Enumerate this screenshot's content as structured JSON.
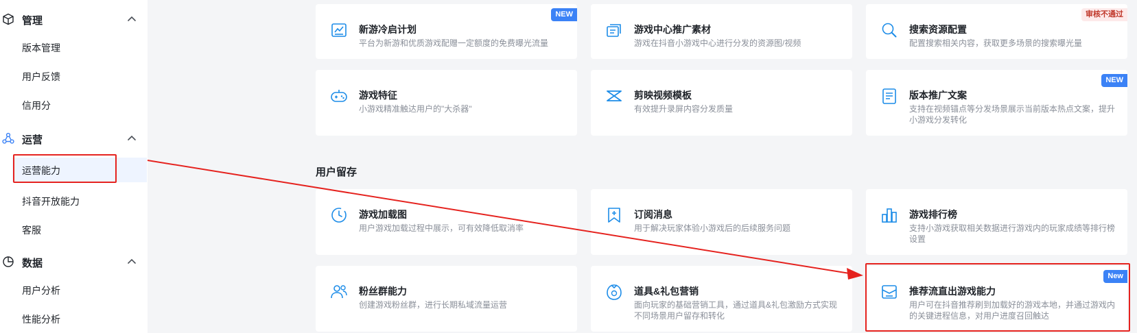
{
  "sidebar": {
    "groups": [
      {
        "label": "管理",
        "icon": "cube-icon",
        "items": [
          "版本管理",
          "用户反馈",
          "信用分"
        ]
      },
      {
        "label": "运营",
        "icon": "operations-icon",
        "items": [
          "运营能力",
          "抖音开放能力",
          "客服"
        ]
      },
      {
        "label": "数据",
        "icon": "pie-chart-icon",
        "items": [
          "用户分析",
          "性能分析"
        ]
      }
    ],
    "active_item": "运营能力"
  },
  "main": {
    "cards_top": [
      {
        "title": "新游冷启计划",
        "desc": "平台为新游和优质游戏配赠一定额度的免费曝光流量",
        "badge": "NEW",
        "icon": "chart-icon"
      },
      {
        "title": "游戏中心推广素材",
        "desc": "游戏在抖音小游戏中心进行分发的资源图/视频",
        "badge": "",
        "icon": "media-stack-icon"
      },
      {
        "title": "搜索资源配置",
        "desc": "配置搜索相关内容，获取更多场景的搜索曝光量",
        "badge": "审核不通过",
        "icon": "search-icon"
      },
      {
        "title": "游戏特征",
        "desc": "小游戏精准触达用户的\"大杀器\"",
        "badge": "",
        "icon": "gamepad-icon"
      },
      {
        "title": "剪映视频模板",
        "desc": "有效提升录屏内容分发质量",
        "badge": "",
        "icon": "capcut-icon"
      },
      {
        "title": "版本推广文案",
        "desc": "支持在视频锚点等分发场景展示当前版本热点文案，提升小游戏分发转化",
        "badge": "NEW",
        "icon": "document-icon"
      }
    ],
    "section_title": "用户留存",
    "cards_retention": [
      {
        "title": "游戏加载图",
        "desc": "用户游戏加载过程中展示，可有效降低取消率",
        "badge": "",
        "icon": "clock-icon"
      },
      {
        "title": "订阅消息",
        "desc": "用于解决玩家体验小游戏后的后续服务问题",
        "badge": "",
        "icon": "bookmark-plus-icon"
      },
      {
        "title": "游戏排行榜",
        "desc": "支持小游戏获取相关数据进行游戏内的玩家成绩等排行榜设置",
        "badge": "",
        "icon": "ranking-icon"
      },
      {
        "title": "粉丝群能力",
        "desc": "创建游戏粉丝群，进行长期私域流量运营",
        "badge": "",
        "icon": "fans-icon"
      },
      {
        "title": "道具&礼包营销",
        "desc": "面向玩家的基础营销工具，通过道具&礼包激励方式实现不同场景用户留存和转化",
        "badge": "",
        "icon": "gift-icon"
      },
      {
        "title": "推荐流直出游戏能力",
        "desc": "用户可在抖音推荐刷到加载好的游戏本地，并通过游戏内的关键进程信息，对用户进度召回触达",
        "badge": "New",
        "icon": "direct-launch-icon"
      }
    ]
  },
  "colors": {
    "accent": "#3b82f6",
    "icon_blue": "#1c8ce8",
    "annotation_red": "#e5221e",
    "reject_badge_text": "#c0392b"
  }
}
